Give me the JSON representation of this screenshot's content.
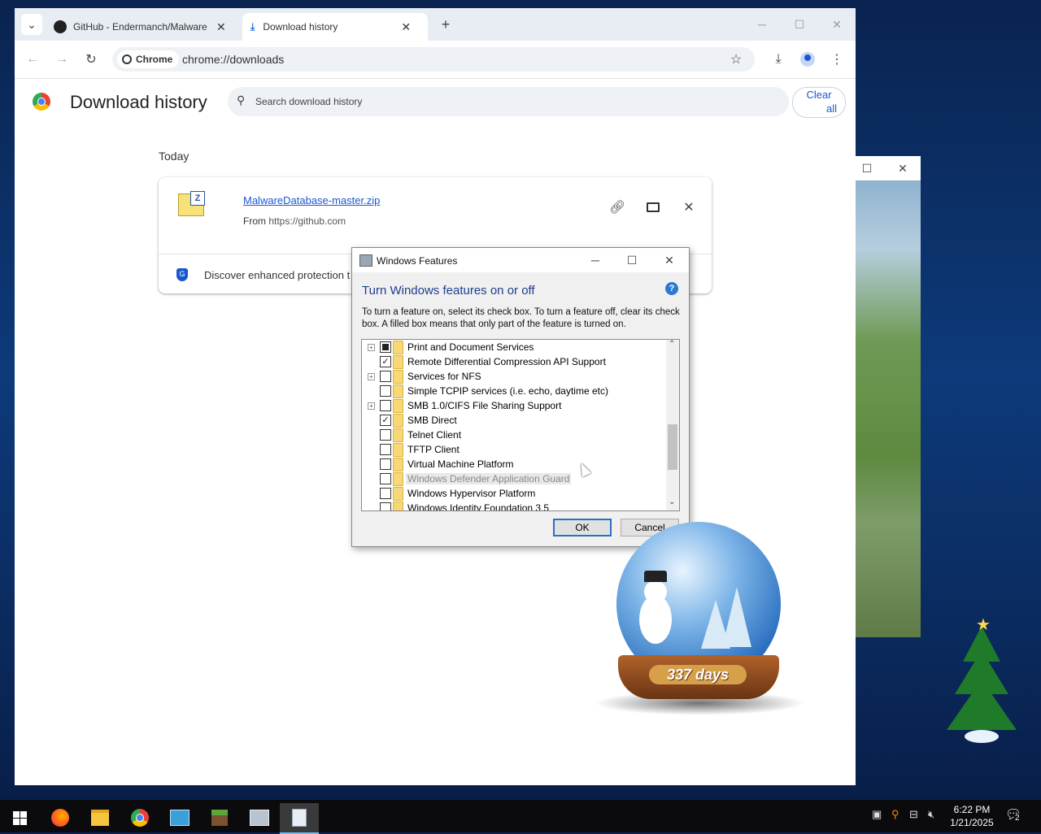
{
  "browser": {
    "tabs": [
      {
        "title": "GitHub - Endermanch/Malware",
        "active": false,
        "icon": "github-icon"
      },
      {
        "title": "Download history",
        "active": true,
        "icon": "download-icon"
      }
    ],
    "url_chip": "Chrome",
    "url": "chrome://downloads",
    "colors": {
      "accent": "#1a57d0",
      "tabbar": "#e8edf3"
    }
  },
  "downloads": {
    "title": "Download history",
    "search_placeholder": "Search download history",
    "clear_all_line1": "Clear",
    "clear_all_line2": "all",
    "section": "Today",
    "item": {
      "filename": "MalwareDatabase-master.zip",
      "from_label": "From",
      "source": "https://github.com"
    },
    "banner_text": "Discover enhanced protection t"
  },
  "dialog": {
    "title": "Windows Features",
    "heading": "Turn Windows features on or off",
    "help": "?",
    "description": "To turn a feature on, select its check box. To turn a feature off, clear its check box. A filled box means that only part of the feature is turned on.",
    "features": [
      {
        "label": "Print and Document Services",
        "state": "partial",
        "expandable": true,
        "disabled": false
      },
      {
        "label": "Remote Differential Compression API Support",
        "state": "checked",
        "expandable": false,
        "disabled": false
      },
      {
        "label": "Services for NFS",
        "state": "unchecked",
        "expandable": true,
        "disabled": false
      },
      {
        "label": "Simple TCPIP services (i.e. echo, daytime etc)",
        "state": "unchecked",
        "expandable": false,
        "disabled": false
      },
      {
        "label": "SMB 1.0/CIFS File Sharing Support",
        "state": "unchecked",
        "expandable": true,
        "disabled": false
      },
      {
        "label": "SMB Direct",
        "state": "checked",
        "expandable": false,
        "disabled": false
      },
      {
        "label": "Telnet Client",
        "state": "unchecked",
        "expandable": false,
        "disabled": false
      },
      {
        "label": "TFTP Client",
        "state": "unchecked",
        "expandable": false,
        "disabled": false
      },
      {
        "label": "Virtual Machine Platform",
        "state": "unchecked",
        "expandable": false,
        "disabled": false
      },
      {
        "label": "Windows Defender Application Guard",
        "state": "unchecked",
        "expandable": false,
        "disabled": true
      },
      {
        "label": "Windows Hypervisor Platform",
        "state": "unchecked",
        "expandable": false,
        "disabled": false
      },
      {
        "label": "Windows Identity Foundation 3.5",
        "state": "unchecked",
        "expandable": false,
        "disabled": false
      }
    ],
    "ok_label": "OK",
    "cancel_label": "Cancel"
  },
  "globe": {
    "counter": "337 days"
  },
  "taskbar": {
    "icons": [
      "windows-start-icon",
      "firefox-icon",
      "file-explorer-icon",
      "chrome-icon",
      "control-panel-icon",
      "minecraft-icon",
      "windows-features-icon",
      "notepad-icon"
    ],
    "time": "6:22 PM",
    "date": "1/21/2025",
    "notification_count": "2"
  }
}
